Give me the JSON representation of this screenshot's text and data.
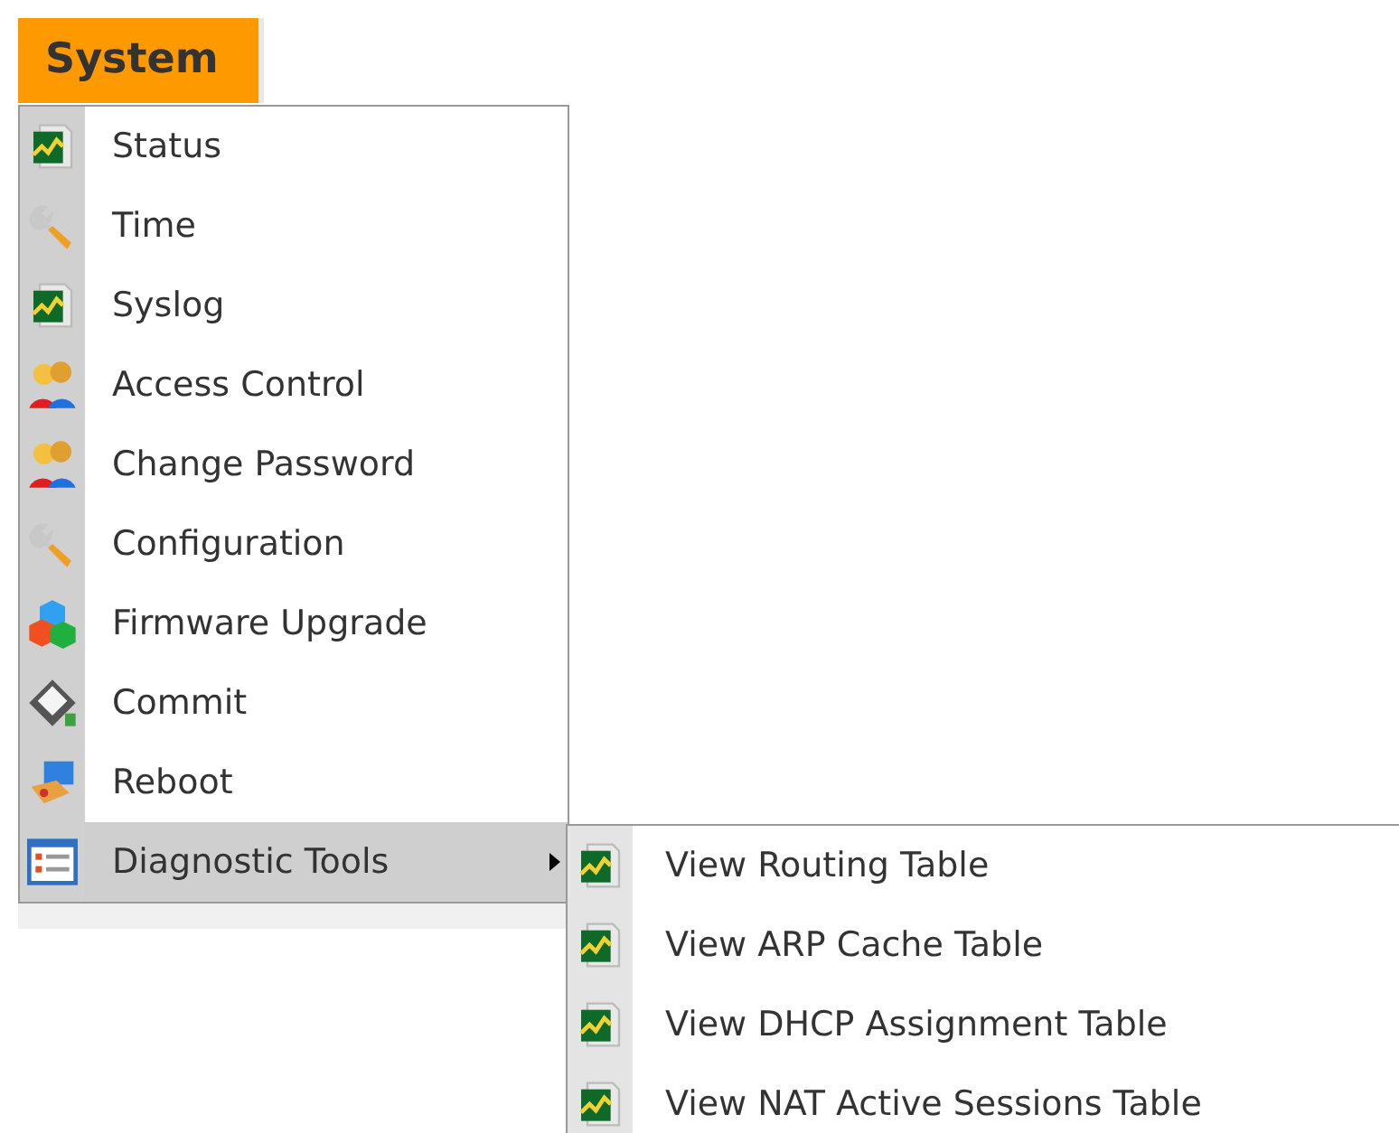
{
  "menu_title": "System",
  "items": [
    {
      "label": "Status",
      "kind": "chart",
      "selected": false,
      "has_submenu": false
    },
    {
      "label": "Time",
      "kind": "wrench",
      "selected": false,
      "has_submenu": false
    },
    {
      "label": "Syslog",
      "kind": "chart",
      "selected": false,
      "has_submenu": false
    },
    {
      "label": "Access Control",
      "kind": "users",
      "selected": false,
      "has_submenu": false
    },
    {
      "label": "Change Password",
      "kind": "users",
      "selected": false,
      "has_submenu": false
    },
    {
      "label": "Configuration",
      "kind": "wrench",
      "selected": false,
      "has_submenu": false
    },
    {
      "label": "Firmware Upgrade",
      "kind": "blocks",
      "selected": false,
      "has_submenu": false
    },
    {
      "label": "Commit",
      "kind": "disk",
      "selected": false,
      "has_submenu": false
    },
    {
      "label": "Reboot",
      "kind": "computer",
      "selected": false,
      "has_submenu": false
    },
    {
      "label": "Diagnostic Tools",
      "kind": "list",
      "selected": true,
      "has_submenu": true
    }
  ],
  "submenu": [
    {
      "label": "View Routing Table",
      "kind": "chart"
    },
    {
      "label": "View ARP Cache Table",
      "kind": "chart"
    },
    {
      "label": "View DHCP Assignment Table",
      "kind": "chart"
    },
    {
      "label": "View NAT Active Sessions Table",
      "kind": "chart"
    }
  ]
}
